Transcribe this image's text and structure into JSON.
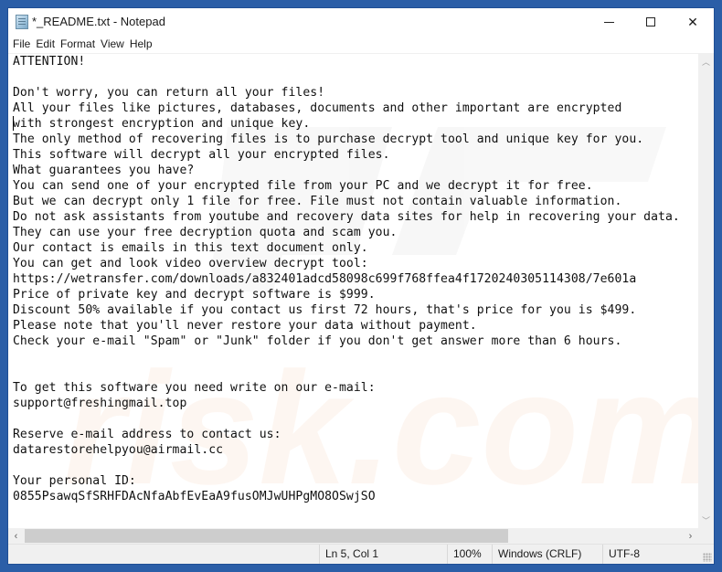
{
  "window": {
    "title": "*_README.txt - Notepad",
    "app_icon": "notepad-icon",
    "controls": {
      "minimize_icon": "minimize-icon",
      "maximize_icon": "maximize-icon",
      "close_icon": "close-icon",
      "close_glyph": "✕"
    }
  },
  "menu": {
    "items": [
      {
        "label": "File"
      },
      {
        "label": "Edit"
      },
      {
        "label": "Format"
      },
      {
        "label": "View"
      },
      {
        "label": "Help"
      }
    ]
  },
  "document": {
    "lines": [
      "ATTENTION!",
      "",
      "Don't worry, you can return all your files!",
      "All your files like pictures, databases, documents and other important are encrypted",
      "with strongest encryption and unique key.",
      "The only method of recovering files is to purchase decrypt tool and unique key for you.",
      "This software will decrypt all your encrypted files.",
      "What guarantees you have?",
      "You can send one of your encrypted file from your PC and we decrypt it for free.",
      "But we can decrypt only 1 file for free. File must not contain valuable information.",
      "Do not ask assistants from youtube and recovery data sites for help in recovering your data.",
      "They can use your free decryption quota and scam you.",
      "Our contact is emails in this text document only.",
      "You can get and look video overview decrypt tool:",
      "https://wetransfer.com/downloads/a832401adcd58098c699f768ffea4f1720240305114308/7e601a",
      "Price of private key and decrypt software is $999.",
      "Discount 50% available if you contact us first 72 hours, that's price for you is $499.",
      "Please note that you'll never restore your data without payment.",
      "Check your e-mail \"Spam\" or \"Junk\" folder if you don't get answer more than 6 hours.",
      "",
      "",
      "To get this software you need write on our e-mail:",
      "support@freshingmail.top",
      "",
      "Reserve e-mail address to contact us:",
      "datarestorehelpyou@airmail.cc",
      "",
      "Your personal ID:",
      "0855PsawqSfSRHFDAcNfaAbfEvEaA9fusOMJwUHPgMO8OSwjSO"
    ],
    "watermark": "PC risk.com"
  },
  "scrollbars": {
    "up_glyph": "︿",
    "down_glyph": "﹀",
    "left_glyph": "‹",
    "right_glyph": "›"
  },
  "statusbar": {
    "position": "Ln 5, Col 1",
    "zoom": "100%",
    "line_ending": "Windows (CRLF)",
    "encoding": "UTF-8"
  }
}
